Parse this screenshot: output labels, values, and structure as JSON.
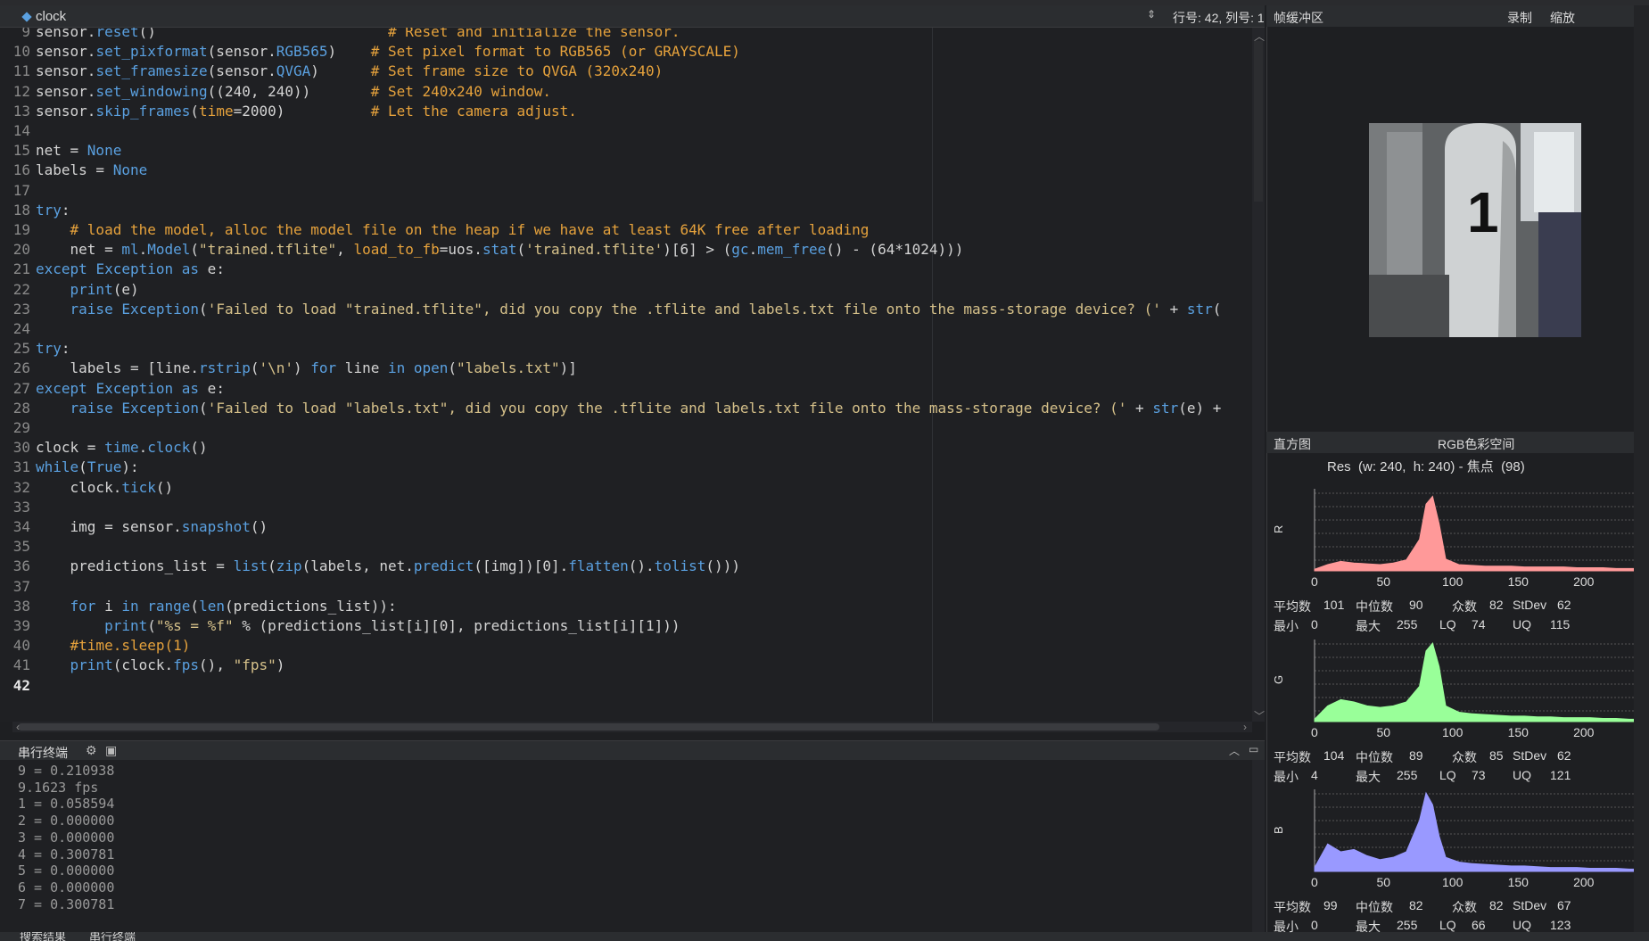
{
  "editor": {
    "filename": "clock",
    "cursor_pos": "行号: 42, 列号: 1",
    "lines": [
      {
        "n": "9",
        "html": "<span>sensor.</span><span class=\"fn2\">reset</span>()                           <span class=\"cm\"># Reset and initialize the sensor.</span>"
      },
      {
        "n": "10",
        "html": "sensor.<span class=\"fn2\">set_pixformat</span>(sensor.<span class=\"fn2\">RGB565</span>)    <span class=\"cm\"># Set pixel format to RGB565 (or GRAYSCALE)</span>"
      },
      {
        "n": "11",
        "html": "sensor.<span class=\"fn2\">set_framesize</span>(sensor.<span class=\"fn2\">QVGA</span>)      <span class=\"cm\"># Set frame size to QVGA (320x240)</span>"
      },
      {
        "n": "12",
        "html": "sensor.<span class=\"fn2\">set_windowing</span>((240, 240))       <span class=\"cm\"># Set 240x240 window.</span>"
      },
      {
        "n": "13",
        "html": "sensor.<span class=\"fn2\">skip_frames</span>(<span class=\"arg\">time</span>=2000)          <span class=\"cm\"># Let the camera adjust.</span>"
      },
      {
        "n": "14",
        "html": ""
      },
      {
        "n": "15",
        "html": "net = <span class=\"none\">None</span>"
      },
      {
        "n": "16",
        "html": "labels = <span class=\"none\">None</span>"
      },
      {
        "n": "17",
        "html": ""
      },
      {
        "n": "18",
        "html": "<span class=\"kw\">try</span>:"
      },
      {
        "n": "19",
        "html": "    <span class=\"cm\"># load the model, alloc the model file on the heap if we have at least 64K free after loading</span>"
      },
      {
        "n": "20",
        "html": "    net = <span class=\"fn2\">ml</span>.<span class=\"fn2\">Model</span>(<span class=\"str\">\"trained.tflite\"</span>, <span class=\"arg\">load_to_fb</span>=uos.<span class=\"fn2\">stat</span>(<span class=\"str\">'trained.tflite'</span>)[6] > (<span class=\"fn2\">gc</span>.<span class=\"fn2\">mem_free</span>() - (64*1024)))"
      },
      {
        "n": "21",
        "html": "<span class=\"kw\">except</span> <span class=\"fn2\">Exception</span> <span class=\"kw\">as</span> e:"
      },
      {
        "n": "22",
        "html": "    <span class=\"fn2\">print</span>(e)"
      },
      {
        "n": "23",
        "html": "    <span class=\"kw\">raise</span> <span class=\"fn2\">Exception</span>(<span class=\"str\">'Failed to load \"trained.tflite\", did you copy the .tflite and labels.txt file onto the mass-storage device? ('</span> + <span class=\"fn2\">str</span>("
      },
      {
        "n": "24",
        "html": ""
      },
      {
        "n": "25",
        "html": "<span class=\"kw\">try</span>:"
      },
      {
        "n": "26",
        "html": "    labels = [line.<span class=\"fn2\">rstrip</span>(<span class=\"str\">'\\n'</span>) <span class=\"kw\">for</span> line <span class=\"kw\">in</span> <span class=\"fn2\">open</span>(<span class=\"str\">\"labels.txt\"</span>)]"
      },
      {
        "n": "27",
        "html": "<span class=\"kw\">except</span> <span class=\"fn2\">Exception</span> <span class=\"kw\">as</span> e:"
      },
      {
        "n": "28",
        "html": "    <span class=\"kw\">raise</span> <span class=\"fn2\">Exception</span>(<span class=\"str\">'Failed to load \"labels.txt\", did you copy the .tflite and labels.txt file onto the mass-storage device? ('</span> + <span class=\"fn2\">str</span>(e) +"
      },
      {
        "n": "29",
        "html": ""
      },
      {
        "n": "30",
        "html": "clock = <span class=\"fn2\">time</span>.<span class=\"fn2\">clock</span>()"
      },
      {
        "n": "31",
        "html": "<span class=\"kw\">while</span>(<span class=\"kw\">True</span>):"
      },
      {
        "n": "32",
        "html": "    clock.<span class=\"fn2\">tick</span>()"
      },
      {
        "n": "33",
        "html": ""
      },
      {
        "n": "34",
        "html": "    img = sensor.<span class=\"fn2\">snapshot</span>()"
      },
      {
        "n": "35",
        "html": ""
      },
      {
        "n": "36",
        "html": "    predictions_list = <span class=\"fn2\">list</span>(<span class=\"fn2\">zip</span>(labels, net.<span class=\"fn2\">predict</span>([img])[0].<span class=\"fn2\">flatten</span>().<span class=\"fn2\">tolist</span>()))"
      },
      {
        "n": "37",
        "html": ""
      },
      {
        "n": "38",
        "html": "    <span class=\"kw\">for</span> i <span class=\"kw\">in</span> <span class=\"fn2\">range</span>(<span class=\"fn2\">len</span>(predictions_list)):"
      },
      {
        "n": "39",
        "html": "        <span class=\"fn2\">print</span>(<span class=\"str\">\"%s = %f\"</span> % (predictions_list[i][0], predictions_list[i][1]))"
      },
      {
        "n": "40",
        "html": "    <span class=\"cm\">#time.sleep(1)</span>"
      },
      {
        "n": "41",
        "html": "    <span class=\"fn2\">print</span>(clock.<span class=\"fn2\">fps</span>(), <span class=\"str\">\"fps\"</span>)"
      },
      {
        "n": "42",
        "html": "",
        "current": true
      }
    ]
  },
  "terminal": {
    "title": "串行终端",
    "lines": [
      "9 = 0.210938",
      "9.1623 fps",
      "1 = 0.058594",
      "2 = 0.000000",
      "3 = 0.000000",
      "4 = 0.300781",
      "5 = 0.000000",
      "6 = 0.000000",
      "7 = 0.300781"
    ]
  },
  "status_bar": {
    "tab1": "搜索结果",
    "tab2": "串行终端"
  },
  "framebuffer": {
    "title": "帧缓冲区",
    "record": "录制",
    "zoom": "缩放"
  },
  "histogram": {
    "title": "直方图",
    "colorspace": "RGB色彩空间",
    "res_line": "Res  (w: 240,  h: 240) - 焦点  (98)",
    "axis_ticks": [
      "0",
      "50",
      "100",
      "150",
      "200"
    ],
    "channels": [
      {
        "label": "R",
        "color": "#ff9999",
        "stats": {
          "mean_label": "平均数",
          "mean": "101",
          "median_label": "中位数",
          "median": "90",
          "mode_label": "众数",
          "mode": "82",
          "stdev_label": "StDev",
          "stdev": "62",
          "min_label": "最小",
          "min": "0",
          "max_label": "最大",
          "max": "255",
          "lq_label": "LQ",
          "lq": "74",
          "uq_label": "UQ",
          "uq": "115"
        }
      },
      {
        "label": "G",
        "color": "#99ff99",
        "stats": {
          "mean_label": "平均数",
          "mean": "104",
          "median_label": "中位数",
          "median": "89",
          "mode_label": "众数",
          "mode": "85",
          "stdev_label": "StDev",
          "stdev": "62",
          "min_label": "最小",
          "min": "4",
          "max_label": "最大",
          "max": "255",
          "lq_label": "LQ",
          "lq": "73",
          "uq_label": "UQ",
          "uq": "121"
        }
      },
      {
        "label": "B",
        "color": "#9999ff",
        "stats": {
          "mean_label": "平均数",
          "mean": "99",
          "median_label": "中位数",
          "median": "82",
          "mode_label": "众数",
          "mode": "82",
          "stdev_label": "StDev",
          "stdev": "67",
          "min_label": "最小",
          "min": "0",
          "max_label": "最大",
          "max": "255",
          "lq_label": "LQ",
          "lq": "66",
          "uq_label": "UQ",
          "uq": "123"
        }
      }
    ]
  },
  "chart_data": {
    "type": "area",
    "x": [
      0,
      10,
      20,
      30,
      40,
      50,
      60,
      70,
      80,
      85,
      90,
      95,
      100,
      110,
      120,
      130,
      140,
      150,
      160,
      170,
      180,
      190,
      200,
      210,
      220,
      230,
      240,
      255
    ],
    "xlim": [
      0,
      255
    ],
    "series": [
      {
        "name": "R",
        "values": [
          2,
          8,
          12,
          10,
          9,
          8,
          10,
          14,
          40,
          85,
          95,
          60,
          15,
          8,
          7,
          6,
          6,
          6,
          5,
          5,
          5,
          5,
          4,
          4,
          4,
          3,
          3,
          3
        ]
      },
      {
        "name": "G",
        "values": [
          3,
          20,
          28,
          25,
          20,
          18,
          20,
          25,
          45,
          90,
          100,
          70,
          20,
          12,
          10,
          9,
          8,
          7,
          7,
          6,
          6,
          5,
          5,
          5,
          4,
          4,
          3,
          3
        ]
      },
      {
        "name": "B",
        "values": [
          5,
          35,
          25,
          28,
          20,
          15,
          18,
          25,
          65,
          100,
          85,
          45,
          18,
          12,
          10,
          9,
          8,
          7,
          7,
          6,
          5,
          5,
          5,
          4,
          4,
          4,
          3,
          3
        ]
      }
    ]
  }
}
